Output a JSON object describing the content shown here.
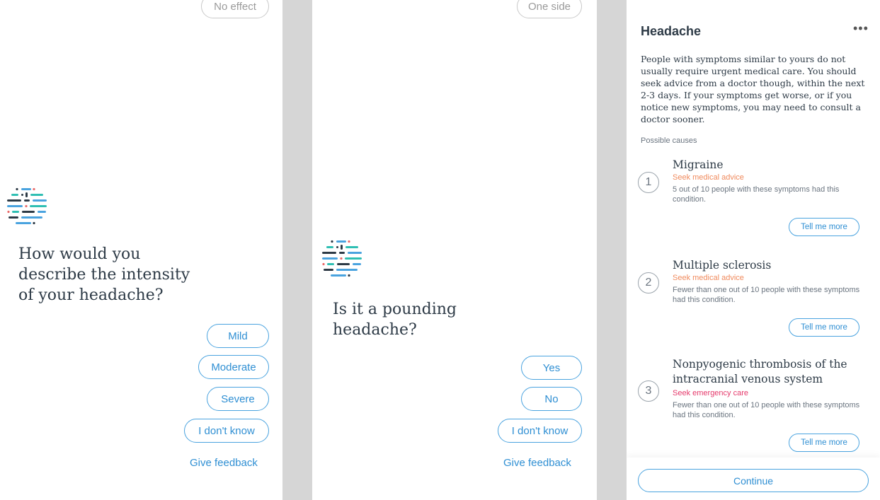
{
  "screen1": {
    "top_option": "No effect",
    "question": "How would you describe the intensity of your headache?",
    "options": [
      "Mild",
      "Moderate",
      "Severe",
      "I don't know"
    ],
    "feedback": "Give feedback"
  },
  "screen2": {
    "top_option": "One side",
    "question": "Is it a pounding headache?",
    "options": [
      "Yes",
      "No",
      "I don't know"
    ],
    "feedback": "Give feedback"
  },
  "screen3": {
    "title": "Headache",
    "menu": "•••",
    "summary": "People with symptoms similar to yours do not usually require urgent medical care. You should seek advice from a doctor though, within the next 2-3 days. If your symptoms get worse, or if you notice new symptoms, you may need to consult a doctor sooner.",
    "causes_label": "Possible causes",
    "causes": [
      {
        "num": "1",
        "name": "Migraine",
        "level": "Seek medical advice",
        "level_color": "#f08a5d",
        "desc": "5 out of 10 people with these symptoms had this condition.",
        "more": "Tell me more"
      },
      {
        "num": "2",
        "name": "Multiple sclerosis",
        "level": "Seek medical advice",
        "level_color": "#f08a5d",
        "desc": "Fewer than one out of 10 people with these symptoms had this condition.",
        "more": "Tell me more"
      },
      {
        "num": "3",
        "name": "Nonpyogenic thrombosis of the intracranial venous system",
        "level": "Seek emergency care",
        "level_color": "#e5396b",
        "desc": "Fewer than one out of 10 people with these symptoms had this condition.",
        "more": "Tell me more"
      }
    ],
    "continue": "Continue"
  },
  "colors": {
    "accent": "#2f8fd3",
    "gutter": "#d6d6d6",
    "text": "#2d3a46"
  },
  "icons": {
    "logo": "symptom-checker-logo-icon",
    "menu": "more-dots-icon"
  }
}
